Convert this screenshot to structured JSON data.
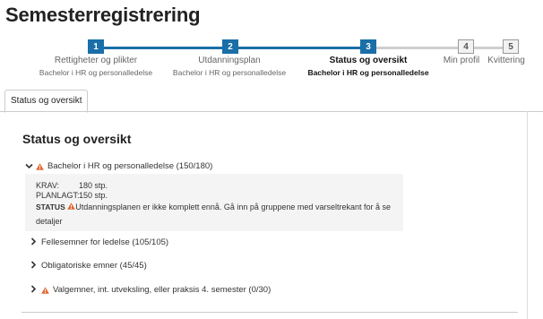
{
  "page": {
    "title": "Semesterregistrering"
  },
  "steps": [
    {
      "number": "1",
      "label": "Rettigheter og plikter",
      "sub": "Bachelor i HR og personalledelse",
      "state": "done"
    },
    {
      "number": "2",
      "label": "Utdanningsplan",
      "sub": "Bachelor i HR og personalledelse",
      "state": "done"
    },
    {
      "number": "3",
      "label": "Status og oversikt",
      "sub": "Bachelor i HR og personalledelse",
      "state": "active"
    },
    {
      "number": "4",
      "label": "Min profil",
      "sub": "",
      "state": "todo"
    },
    {
      "number": "5",
      "label": "Kvittering",
      "sub": "",
      "state": "todo"
    }
  ],
  "tabs": [
    {
      "label": "Status og oversikt"
    }
  ],
  "overview": {
    "title": "Status og oversikt",
    "program": {
      "label": "Bachelor i HR og personalledelse (150/180)",
      "icon": "warning-icon",
      "expanded": true
    },
    "details": {
      "krav_key": "KRAV:",
      "krav_value": "180 stp.",
      "planlagt_key": "PLANLAGT:",
      "planlagt_value": "150 stp.",
      "status_key": "STATUS",
      "status_text": "Utdanningsplanen er ikke komplett ennå. Gå inn på gruppene med varseltrekant for å se detaljer"
    },
    "groups": [
      {
        "label": "Fellesemner for ledelse (105/105)",
        "warning": false
      },
      {
        "label": "Obligatoriske emner (45/45)",
        "warning": false
      },
      {
        "label": "Valgemner, int. utveksling, eller praksis 4. semester (0/30)",
        "warning": true
      }
    ]
  },
  "colors": {
    "accent": "#1a6fa8",
    "warning": "#e0662e",
    "panel": "#f4f4f4"
  }
}
